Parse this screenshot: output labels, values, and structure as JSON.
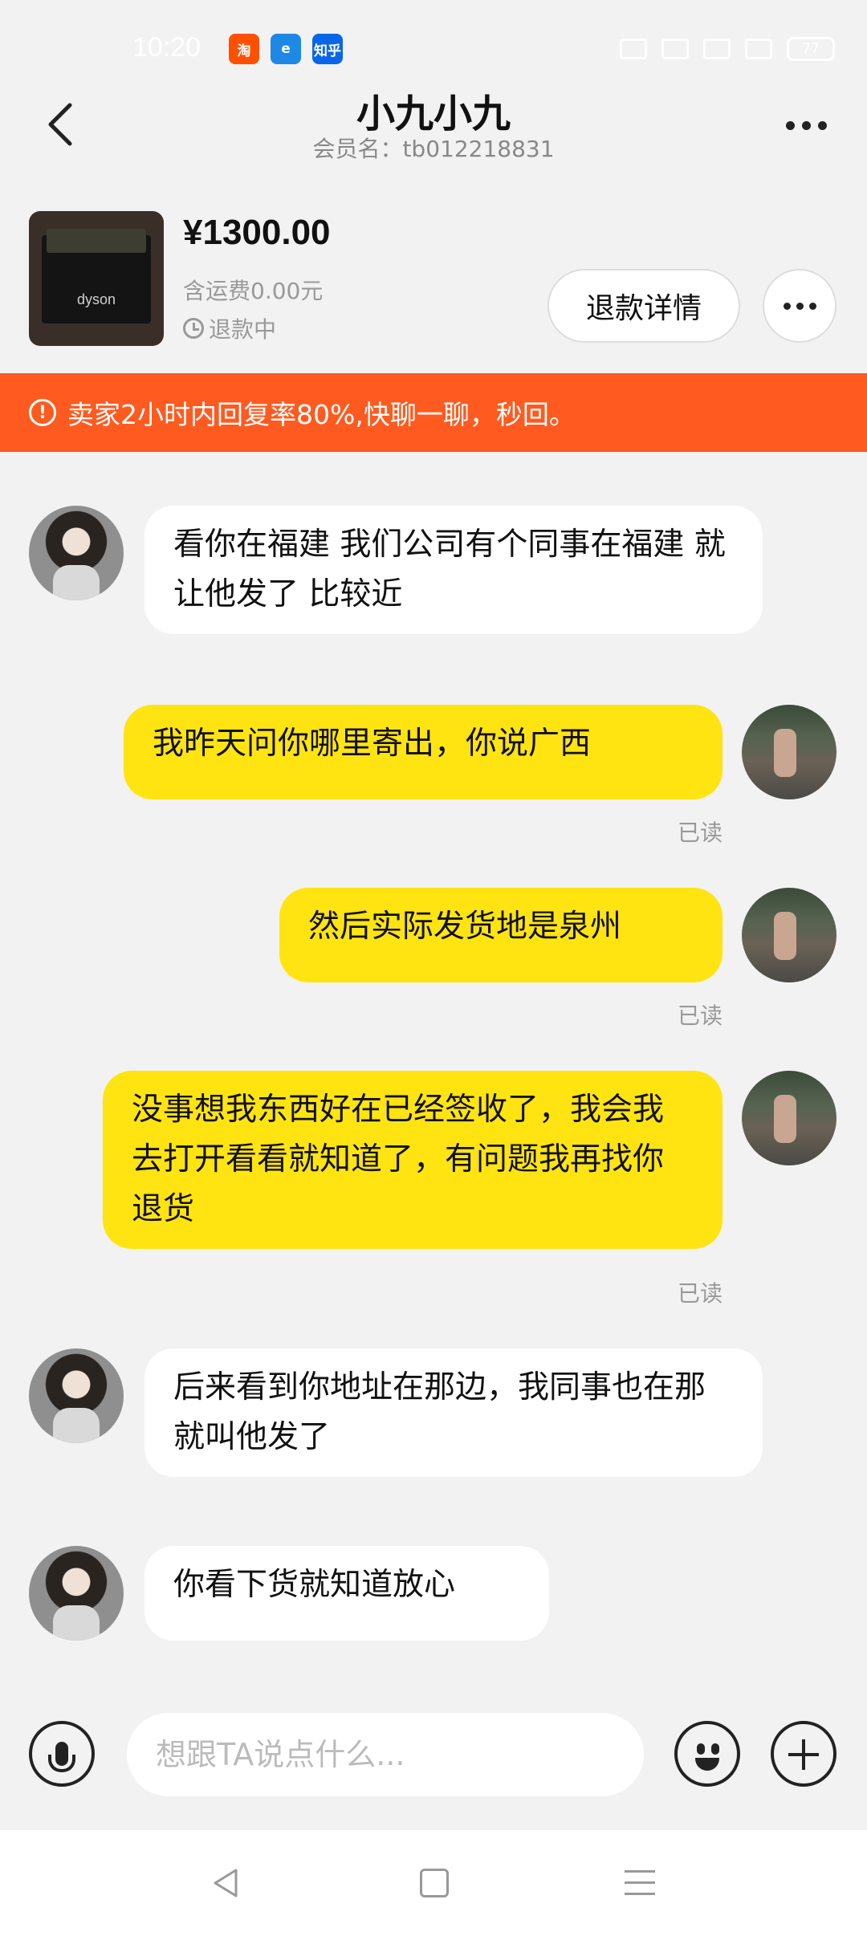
{
  "status_bar": {
    "time": "10:20",
    "apps": [
      {
        "name": "taobao-app-icon",
        "label": "淘",
        "color": "#ff5000"
      },
      {
        "name": "eleme-app-icon",
        "label": "e",
        "color": "#1e88e5"
      },
      {
        "name": "zhihu-app-icon",
        "label": "知乎",
        "color": "#0a66e8"
      }
    ],
    "battery": "77"
  },
  "header": {
    "title": "小九小九",
    "subtitle": "会员名：tb012218831"
  },
  "product": {
    "brand_text": "dyson",
    "price": "¥1300.00",
    "shipping": "含运费0.00元",
    "status": "退款中",
    "refund_button": "退款详情"
  },
  "notice": {
    "icon": "!",
    "text": "卖家2小时内回复率80%,快聊一聊，秒回。"
  },
  "messages": [
    {
      "side": "in",
      "text": "看你在福建 我们公司有个同事在福建 就让他发了 比较近"
    },
    {
      "side": "out",
      "text": "我昨天问你哪里寄出，你说广西",
      "read": "已读"
    },
    {
      "side": "out",
      "text": "然后实际发货地是泉州",
      "read": "已读"
    },
    {
      "side": "out",
      "text": "没事想我东西好在已经签收了，我会我去打开看看就知道了，有问题我再找你退货",
      "read": "已读"
    },
    {
      "side": "in",
      "text": "后来看到你地址在那边，我同事也在那 就叫他发了"
    },
    {
      "side": "in",
      "text": "你看下货就知道放心"
    }
  ],
  "input": {
    "placeholder": "想跟TA说点什么..."
  },
  "colors": {
    "notice_bg": "#ff5a1f",
    "outgoing_bubble": "#ffe412",
    "incoming_bubble": "#ffffff",
    "page_bg": "#f2f2f2"
  }
}
